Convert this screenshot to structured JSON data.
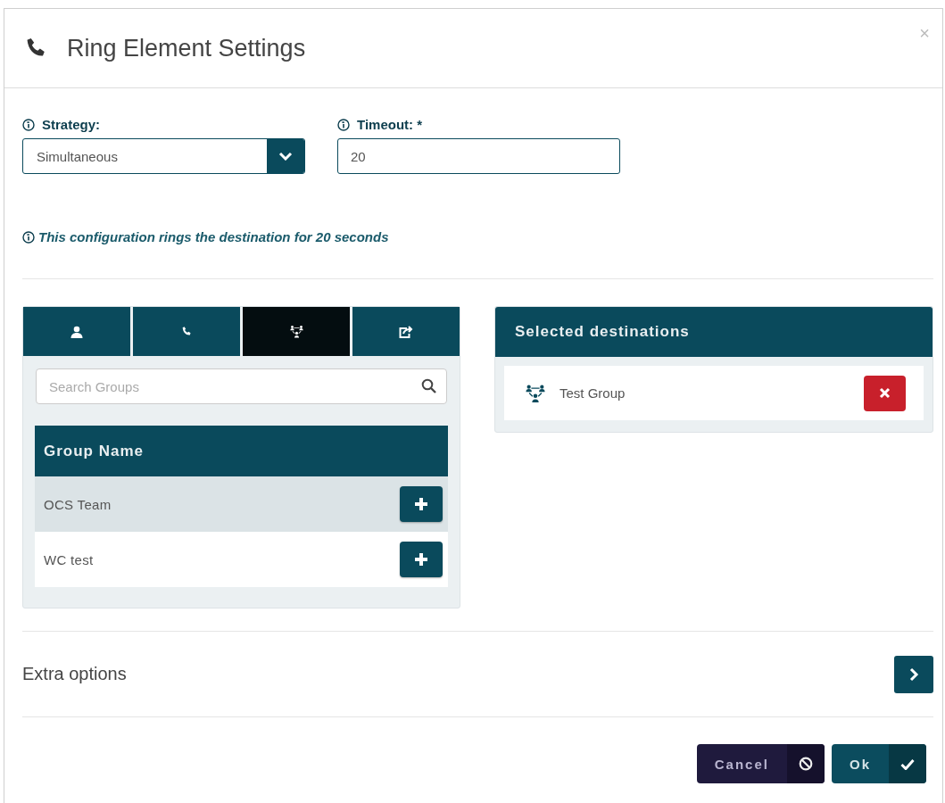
{
  "dialog": {
    "title": "Ring Element Settings",
    "close": "×"
  },
  "strategy": {
    "label": "Strategy:",
    "value": "Simultaneous"
  },
  "timeout": {
    "label": "Timeout: *",
    "value": "20"
  },
  "info": "This configuration rings the destination for 20 seconds",
  "tabs": [
    {
      "kind": "user",
      "selected": false
    },
    {
      "kind": "phone",
      "selected": false
    },
    {
      "kind": "group",
      "selected": true
    },
    {
      "kind": "forward",
      "selected": false
    }
  ],
  "search": {
    "placeholder": "Search Groups"
  },
  "table": {
    "columns": [
      "Group Name"
    ],
    "rows": [
      {
        "name": "OCS Team",
        "selected": true
      },
      {
        "name": "WC test",
        "selected": false
      }
    ]
  },
  "destinations": {
    "title": "Selected destinations",
    "items": [
      {
        "kind": "group",
        "name": "Test Group"
      }
    ]
  },
  "extra_options": {
    "label": "Extra options",
    "expanded": false
  },
  "buttons": [
    {
      "kind": "cancel",
      "label": "Cancel"
    },
    {
      "kind": "ok",
      "label": "Ok"
    }
  ]
}
